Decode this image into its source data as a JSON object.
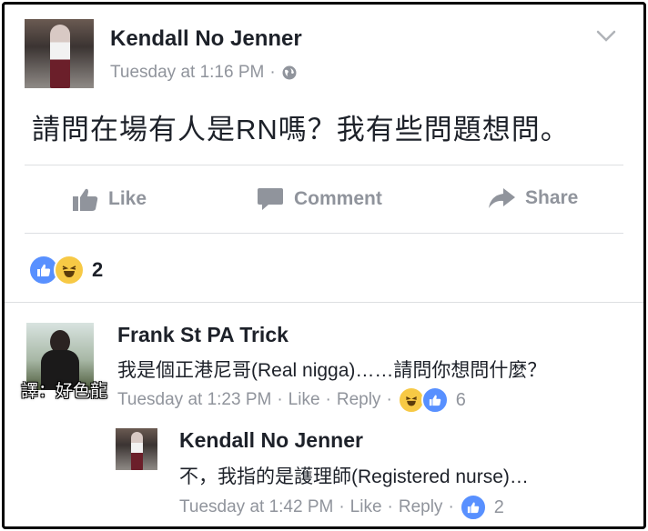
{
  "post": {
    "author": "Kendall No Jenner",
    "time": "Tuesday at 1:16 PM",
    "separator": "·",
    "text": "請問在場有人是RN嗎？我有些問題想問。"
  },
  "actions": {
    "like": "Like",
    "comment": "Comment",
    "share": "Share"
  },
  "reactions": {
    "count": "2"
  },
  "comments": [
    {
      "author": "Frank St PA Trick",
      "text": "我是個正港尼哥(Real nigga)……請問你想問什麼？",
      "time": "Tuesday at 1:23 PM",
      "like": "Like",
      "reply": "Reply",
      "reaction_count": "6",
      "watermark": "譯：好色龍"
    },
    {
      "author": "Kendall No Jenner",
      "text": "不，我指的是護理師(Registered nurse)…",
      "time": "Tuesday at 1:42 PM",
      "like": "Like",
      "reply": "Reply",
      "reaction_count": "2"
    }
  ],
  "icons": {
    "menu": "chevron-down-icon",
    "privacy": "globe-icon",
    "like": "thumbs-up-icon",
    "comment": "comment-bubble-icon",
    "share": "share-arrow-icon",
    "reaction_like": "like-reaction-icon",
    "reaction_haha": "haha-reaction-icon"
  },
  "colors": {
    "text": "#1d2129",
    "meta": "#90949c",
    "like_blue": "#5890ff",
    "haha_yellow": "#f7c945",
    "divider": "#dddfe2"
  }
}
